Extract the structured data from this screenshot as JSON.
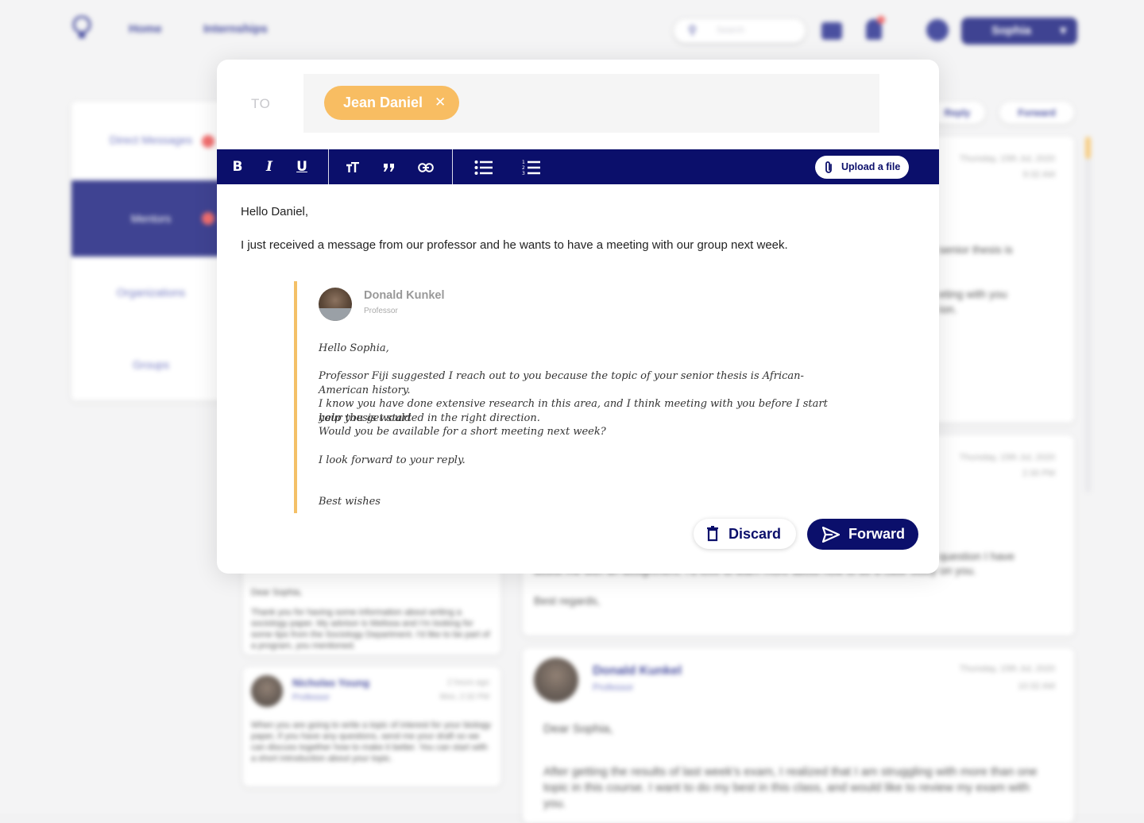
{
  "background": {
    "nav": {
      "home": "Home",
      "internships": "Internships"
    },
    "search_placeholder": "Search",
    "user_name": "Sophia",
    "sidebar": [
      "Direct Messages",
      "Mentors",
      "Organizations",
      "Groups"
    ],
    "actions": {
      "reply": "Reply",
      "forward": "Forward"
    },
    "timestamps": {
      "date": "Thursday, 15th Jul, 2020",
      "time1": "9:32 AM",
      "time2": "2:30 PM",
      "time3": "10:32 AM",
      "ago": "2 hours ago",
      "ago_time": "9:32 AM"
    },
    "thread_fragments": {
      "line1": "senior thesis is",
      "line2": "eting with you",
      "line3": "ion.",
      "question": "question I have",
      "question2": "assist me with an assignment. I'd love to learn more about how to do a case study on you.",
      "regards": "Best regards,"
    },
    "list_cards": [
      {
        "greeting": "Dear Sophia,",
        "text": "Thank you for having some information about writing a sociology paper. My advisor is Melissa and I'm looking for some tips from the Sociology Department. I'd like to be part of a program, you mentioned."
      },
      {
        "name": "Nicholas Young",
        "role": "Professor",
        "ago": "2 hours ago",
        "time": "Mon, 2:32 PM",
        "text": "When you are going to write a topic of interest for your biology paper, if you have any questions, send me your draft so we can discuss together how to make it better. You can start with a short introduction about your topic."
      }
    ],
    "message": {
      "name": "Donald Kunkel",
      "role": "Professor",
      "date": "Thursday, 15th Jul, 2020",
      "time": "10:32 AM",
      "greeting": "Dear Sophia,",
      "text": "After getting the results of last week's exam, I realized that I am struggling with more than one topic in this course. I want to do my best in this class, and would like to review my exam with you."
    }
  },
  "compose": {
    "to_label": "TO",
    "recipient": "Jean Daniel",
    "toolbar": {
      "upload_label": "Upload a file"
    },
    "body": [
      "Hello Daniel,",
      "I just received a message from our professor and he wants to have a meeting with our group next week."
    ],
    "quoted": {
      "sender_name": "Donald Kunkel",
      "sender_role": "Professor",
      "lines": [
        "Hello Sophia,",
        "Professor Fiji suggested I reach out to you because the topic of your senior thesis is African-American history.",
        "I know you have done extensive research in this area, and I think meeting with you before I start your thesis would",
        "help you get started in the right direction.",
        "Would you be available for a short meeting next week?",
        "I look forward to your reply.",
        "Best wishes"
      ]
    },
    "discard_label": "Discard",
    "forward_label": "Forward"
  },
  "colors": {
    "navy": "#0b0f6b",
    "chip": "#f8bd62",
    "quote_bar": "#f4c067",
    "badge_red": "#f04f4f"
  }
}
